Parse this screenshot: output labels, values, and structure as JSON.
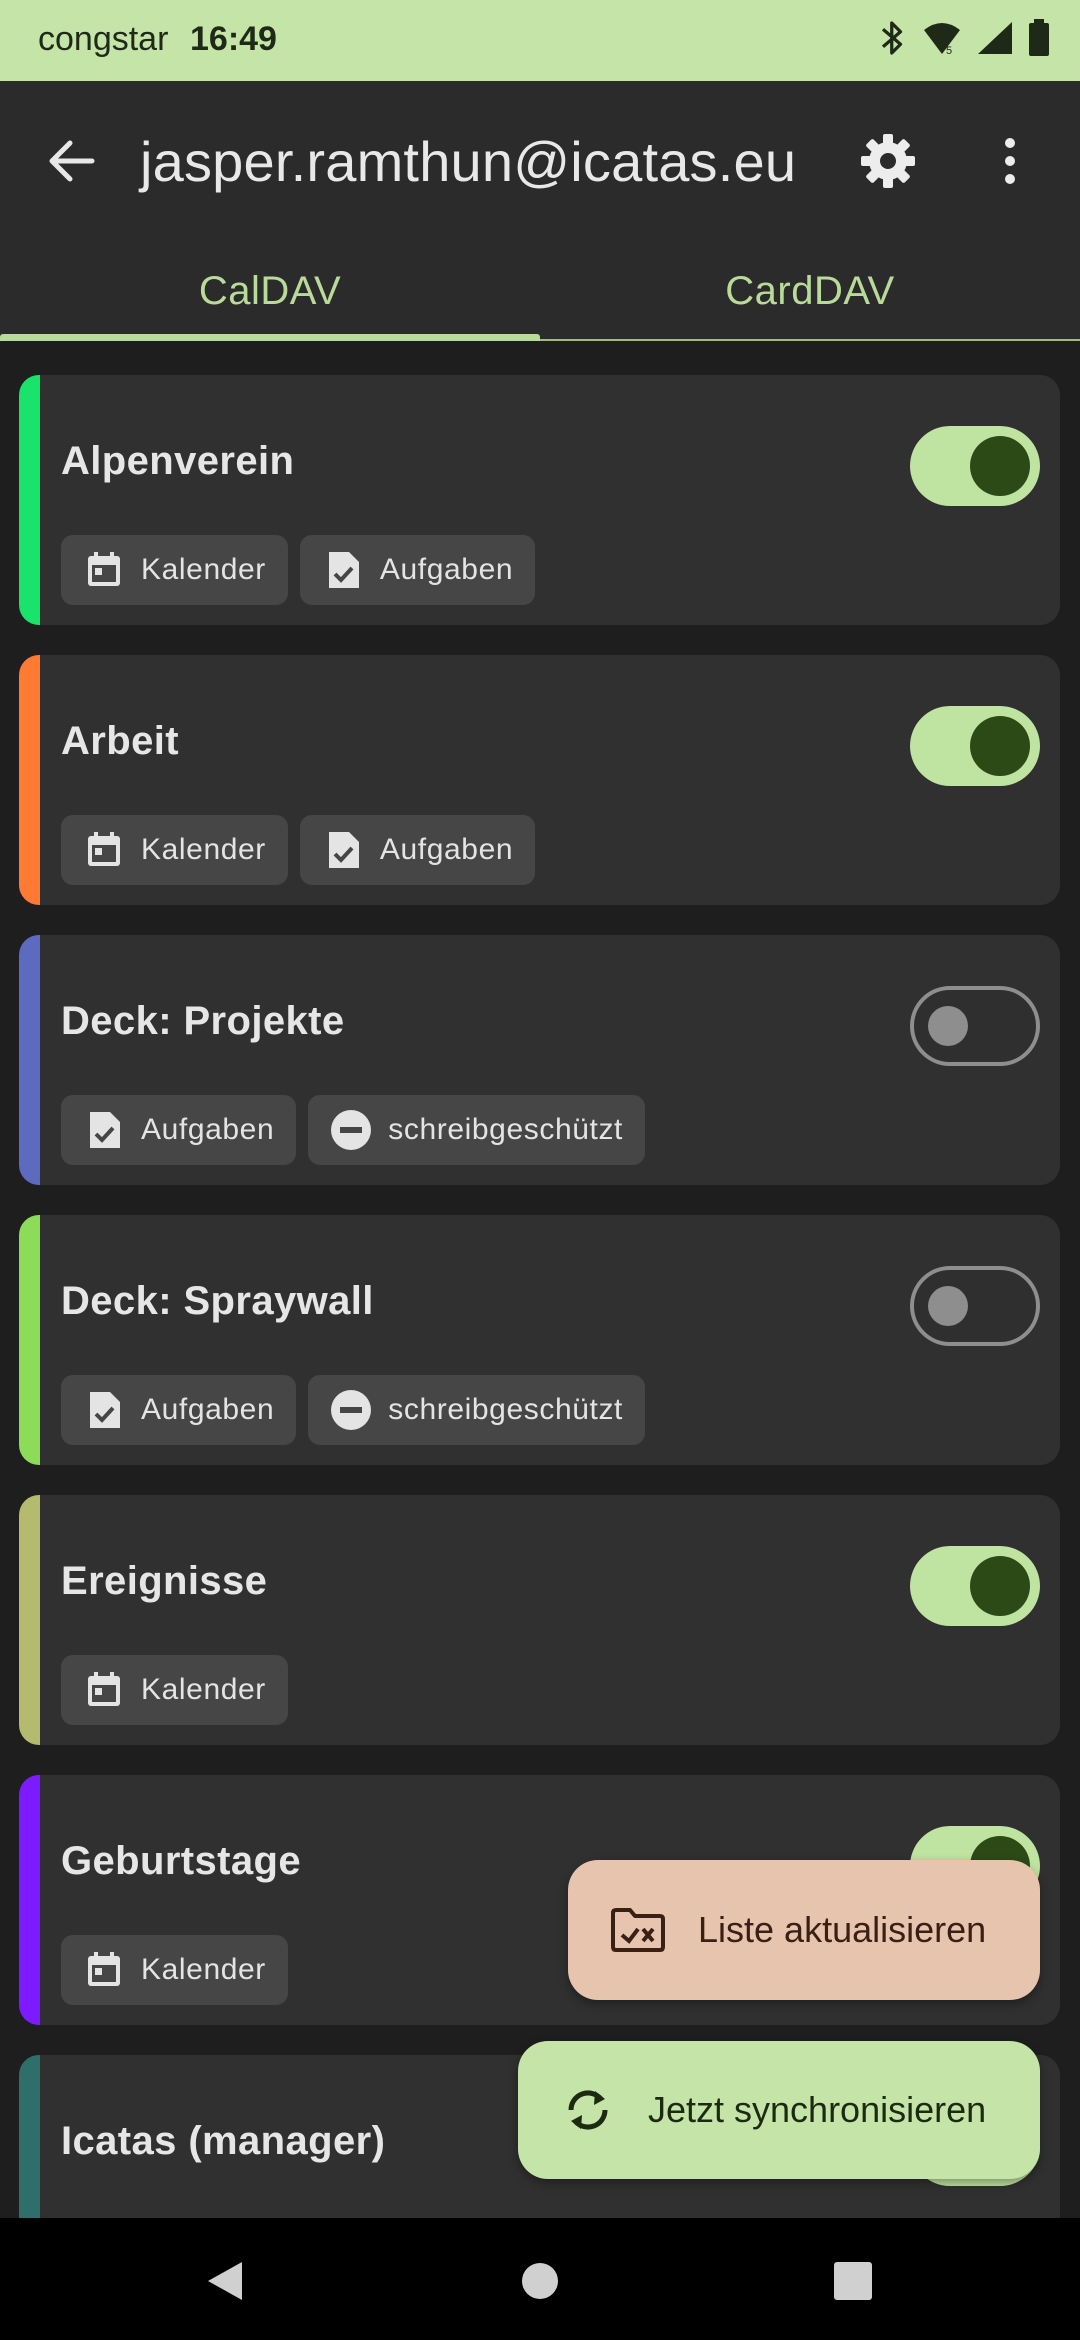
{
  "status_bar": {
    "carrier": "congstar",
    "time": "16:49",
    "icons": [
      "bluetooth-icon",
      "wifi-icon",
      "signal-icon",
      "battery-icon"
    ]
  },
  "app_bar": {
    "title": "jasper.ramthun@icatas.eu",
    "back_icon": "arrow-back-icon",
    "settings_icon": "gear-icon",
    "menu_icon": "more-vert-icon"
  },
  "tabs": [
    {
      "label": "CalDAV",
      "selected": true
    },
    {
      "label": "CardDAV",
      "selected": false
    }
  ],
  "collections": [
    {
      "name": "Alpenverein",
      "color": "#19e36a",
      "enabled": true,
      "chips": [
        {
          "icon": "calendar-icon",
          "label": "Kalender"
        },
        {
          "icon": "task-icon",
          "label": "Aufgaben"
        }
      ]
    },
    {
      "name": "Arbeit",
      "color": "#ff7a33",
      "enabled": true,
      "chips": [
        {
          "icon": "calendar-icon",
          "label": "Kalender"
        },
        {
          "icon": "task-icon",
          "label": "Aufgaben"
        }
      ]
    },
    {
      "name": "Deck: Projekte",
      "color": "#5c6bc0",
      "enabled": false,
      "chips": [
        {
          "icon": "task-icon",
          "label": "Aufgaben"
        },
        {
          "icon": "read-only-icon",
          "label": "schreibgeschützt"
        }
      ]
    },
    {
      "name": "Deck: Spraywall",
      "color": "#8cdc5a",
      "enabled": false,
      "chips": [
        {
          "icon": "task-icon",
          "label": "Aufgaben"
        },
        {
          "icon": "read-only-icon",
          "label": "schreibgeschützt"
        }
      ]
    },
    {
      "name": "Ereignisse",
      "color": "#b5bb6e",
      "enabled": true,
      "chips": [
        {
          "icon": "calendar-icon",
          "label": "Kalender"
        }
      ]
    },
    {
      "name": "Geburtstage",
      "color": "#7c1bff",
      "enabled": true,
      "chips": [
        {
          "icon": "calendar-icon",
          "label": "Kalender"
        }
      ]
    },
    {
      "name": "Icatas (manager)",
      "color": "#2f6f6a",
      "enabled": true,
      "chips": []
    }
  ],
  "fabs": {
    "refresh_label": "Liste aktualisieren",
    "sync_label": "Jetzt synchronisieren"
  },
  "nav_bar": {
    "back": "nav-back-icon",
    "home": "nav-home-icon",
    "recents": "nav-recents-icon"
  }
}
